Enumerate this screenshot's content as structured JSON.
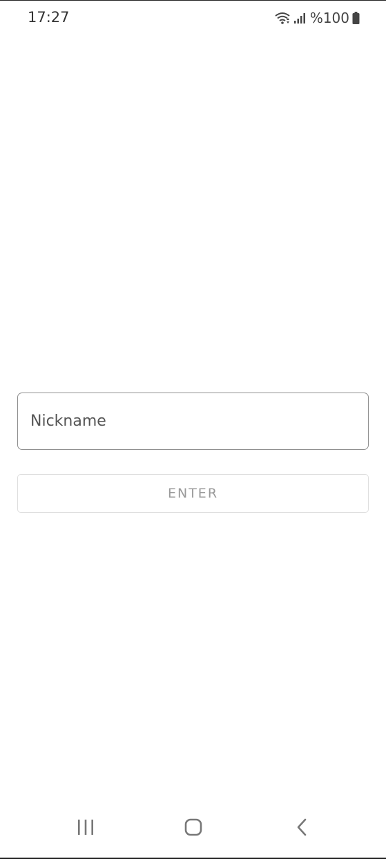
{
  "status_bar": {
    "time": "17:27",
    "battery": "%100",
    "icons": [
      "wifi-icon",
      "signal-icon",
      "battery-icon"
    ]
  },
  "form": {
    "nickname_placeholder": "Nickname",
    "nickname_value": "",
    "enter_label": "ENTER"
  },
  "nav_bar": {
    "icons": [
      "recents-icon",
      "home-icon",
      "back-icon"
    ]
  },
  "colors": {
    "background": "#ffffff",
    "field_border": "#8f8f8f",
    "button_text": "#9a9a9a",
    "button_border": "#dedede"
  }
}
